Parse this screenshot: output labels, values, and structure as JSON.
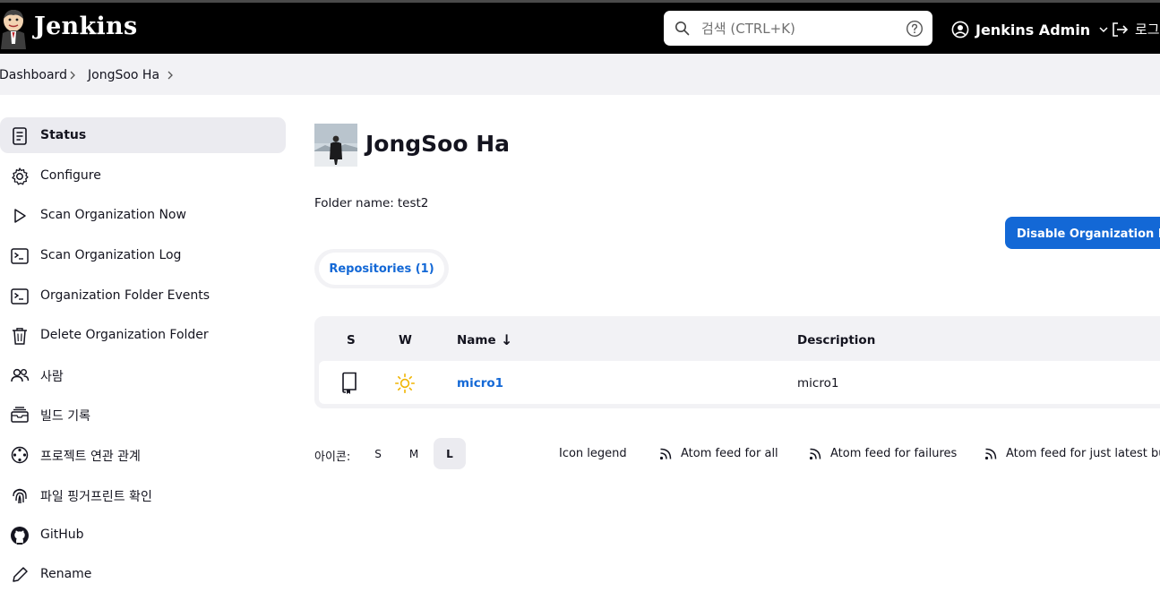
{
  "header": {
    "brand": "Jenkins",
    "search_placeholder": "검색 (CTRL+K)",
    "user_name": "Jenkins Admin",
    "logout_label": "로그"
  },
  "breadcrumb": [
    "Dashboard",
    "JongSoo Ha"
  ],
  "sidebar": {
    "items": [
      {
        "label": "Status",
        "icon": "status-icon"
      },
      {
        "label": "Configure",
        "icon": "gear-icon"
      },
      {
        "label": "Scan Organization Now",
        "icon": "play-icon"
      },
      {
        "label": "Scan Organization Log",
        "icon": "terminal-icon"
      },
      {
        "label": "Organization Folder Events",
        "icon": "terminal-icon"
      },
      {
        "label": "Delete Organization Folder",
        "icon": "trash-icon"
      },
      {
        "label": "사람",
        "icon": "people-icon"
      },
      {
        "label": "빌드 기록",
        "icon": "build-history-icon"
      },
      {
        "label": "프로젝트 연관 관계",
        "icon": "relationship-icon"
      },
      {
        "label": "파일 핑거프린트 확인",
        "icon": "fingerprint-icon"
      },
      {
        "label": "GitHub",
        "icon": "github-icon"
      },
      {
        "label": "Rename",
        "icon": "pencil-icon"
      }
    ]
  },
  "main": {
    "title": "JongSoo Ha",
    "folder_name_label": "Folder name:",
    "folder_name_value": "test2",
    "disable_button": "Disable Organization Folder",
    "tab_label": "Repositories (1)",
    "table": {
      "headers": {
        "s": "S",
        "w": "W",
        "name": "Name",
        "sort_arrow": "↓",
        "description": "Description"
      },
      "rows": [
        {
          "name": "micro1",
          "description": "micro1",
          "status_icon": "repository-icon",
          "weather_icon": "sun-icon"
        }
      ]
    },
    "icon_size": {
      "label": "아이콘:",
      "options": [
        "S",
        "M",
        "L"
      ],
      "selected": "L"
    },
    "footer_links": [
      {
        "label": "Icon legend",
        "icon": ""
      },
      {
        "label": "Atom feed for all",
        "icon": "rss-icon"
      },
      {
        "label": "Atom feed for failures",
        "icon": "rss-icon"
      },
      {
        "label": "Atom feed for just latest builds",
        "icon": "rss-icon"
      }
    ]
  },
  "colors": {
    "header_bg": "#000000",
    "accent": "#1368d6",
    "sidebar_active": "#ebebf0",
    "crumb_bg": "#f2f2f5",
    "weather_sun": "#f0b400"
  }
}
